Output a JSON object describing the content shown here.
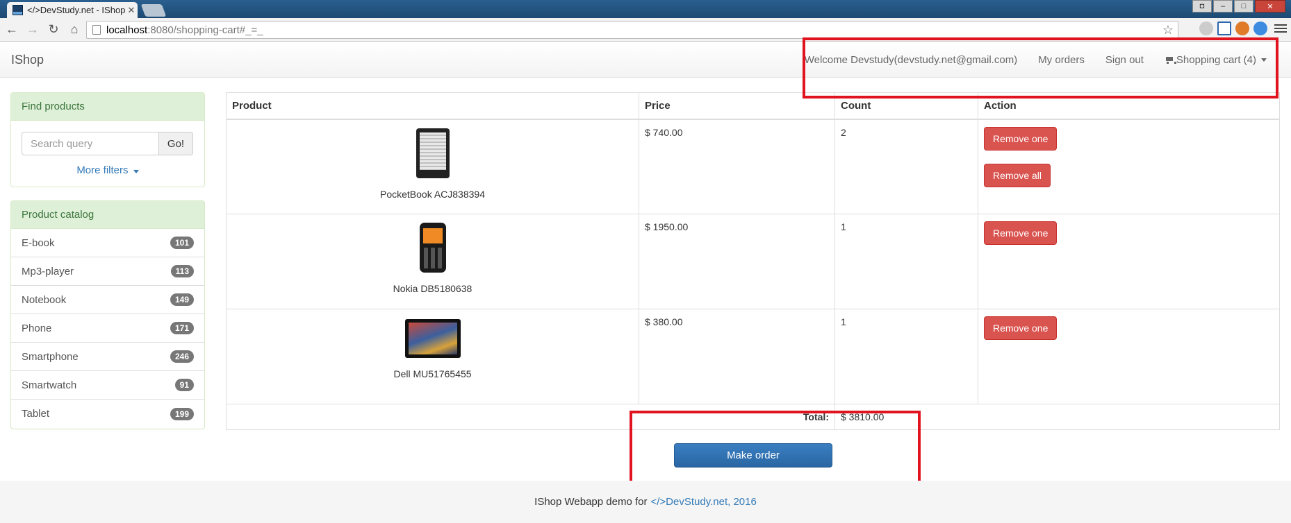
{
  "browser": {
    "tab_title": "</>DevStudy.net - IShop",
    "url_host": "localhost",
    "url_path": ":8080/shopping-cart#_=_"
  },
  "navbar": {
    "brand": "IShop",
    "welcome": "Welcome Devstudy(devstudy.net@gmail.com)",
    "my_orders": "My orders",
    "sign_out": "Sign out",
    "cart": "Shopping cart (4)"
  },
  "search": {
    "heading": "Find products",
    "placeholder": "Search query",
    "go_label": "Go!",
    "more_filters": "More filters"
  },
  "catalog": {
    "heading": "Product catalog",
    "items": [
      {
        "label": "E-book",
        "count": "101"
      },
      {
        "label": "Mp3-player",
        "count": "113"
      },
      {
        "label": "Notebook",
        "count": "149"
      },
      {
        "label": "Phone",
        "count": "171"
      },
      {
        "label": "Smartphone",
        "count": "246"
      },
      {
        "label": "Smartwatch",
        "count": "91"
      },
      {
        "label": "Tablet",
        "count": "199"
      }
    ]
  },
  "cart": {
    "columns": [
      "Product",
      "Price",
      "Count",
      "Action"
    ],
    "rows": [
      {
        "name": "PocketBook ACJ838394",
        "price": "$ 740.00",
        "count": "2",
        "image": "ebook-reader"
      },
      {
        "name": "Nokia DB5180638",
        "price": "$ 1950.00",
        "count": "1",
        "image": "mobile-phone"
      },
      {
        "name": "Dell MU51765455",
        "price": "$ 380.00",
        "count": "1",
        "image": "tablet"
      }
    ],
    "remove_one": "Remove one",
    "remove_all": "Remove all",
    "total_label": "Total:",
    "total_value": "$ 3810.00",
    "make_order": "Make order"
  },
  "footer": {
    "text": "IShop Webapp demo for",
    "link": "</>DevStudy.net, 2016"
  },
  "colors": {
    "annotation": "#e0131f",
    "danger": "#d9534f",
    "primary": "#2a66a3",
    "panel_heading": "#dff0d8"
  }
}
